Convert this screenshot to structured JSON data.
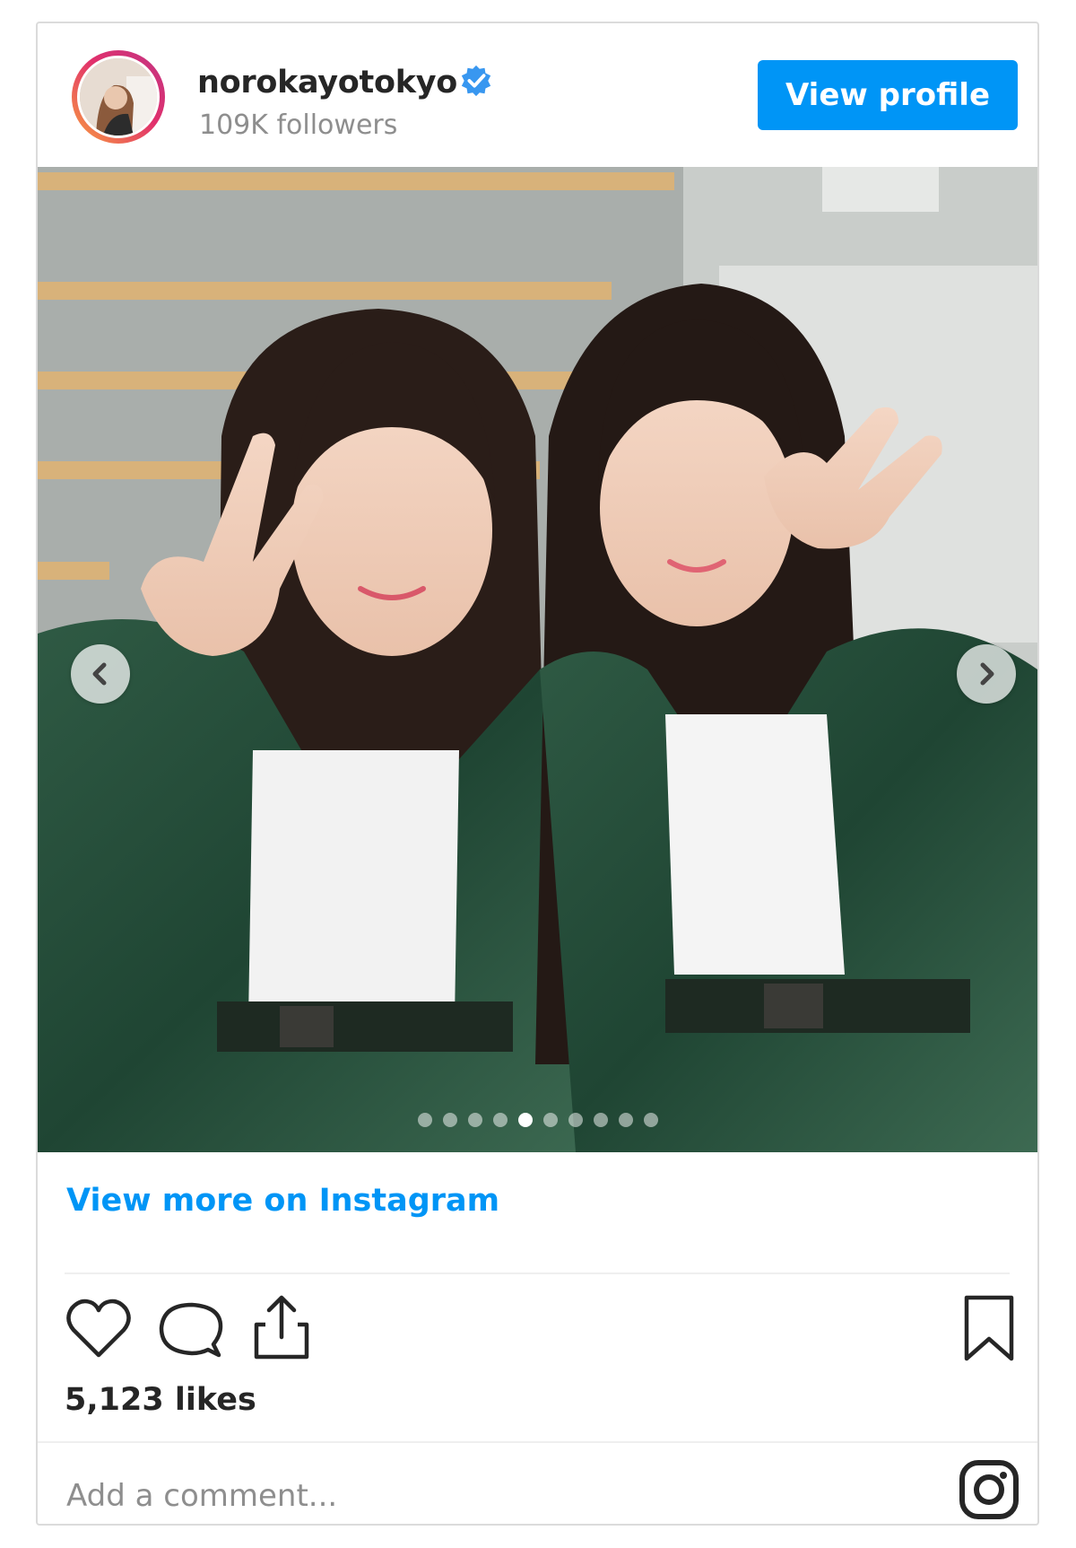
{
  "header": {
    "username": "norokayotokyo",
    "followers": "109K followers",
    "view_profile_label": "View profile",
    "verified_icon": "verified-badge-icon"
  },
  "carousel": {
    "slide_count": 10,
    "active_index": 4
  },
  "links": {
    "view_more": "View more on Instagram"
  },
  "actions": {
    "like_icon": "heart-icon",
    "comment_icon": "comment-icon",
    "share_icon": "share-icon",
    "save_icon": "bookmark-icon"
  },
  "likes_text": "5,123 likes",
  "comment": {
    "placeholder": "Add a comment...",
    "value": ""
  },
  "colors": {
    "accent": "#0095f6",
    "text": "#262626",
    "muted": "#8e8e8e"
  }
}
